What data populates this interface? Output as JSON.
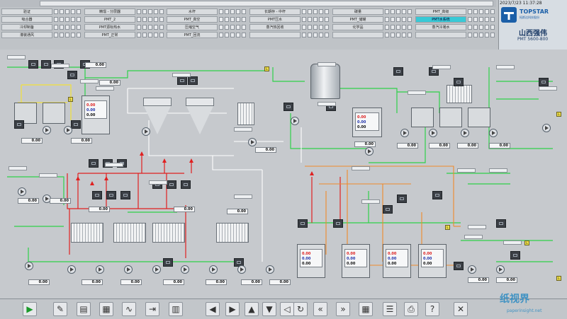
{
  "header": {
    "datetime": "2023/7/23 11:37:28",
    "logo_text": "TOPSTAR",
    "logo_sub": "拓斯达科技股份",
    "site": "山西强伟",
    "model": "PMT 5600-800",
    "alarm_rows": [
      [
        "验证",
        "精馏 - 分层器",
        "水杆",
        "长期存 - 中杆",
        "碳量",
        "PMT_高级"
      ],
      [
        "吸合器",
        "PMT_2",
        "PMT_真空",
        "PMT压水",
        "PMT_储罐",
        "PMT水系统"
      ],
      [
        "冷却制备",
        "PMT源标热水",
        "压缩空气",
        "蒸汽热回收",
        "化学品",
        "蒸汽冷凝水"
      ],
      [
        "灌装通风",
        "PMT_正常",
        "PMT_回流",
        "",
        "",
        ""
      ]
    ],
    "active_alarm": "PMT水系统"
  },
  "process": {
    "values": [
      "0.00",
      "0.00",
      "0.00",
      "0.00",
      "0.00",
      "0.00",
      "0.00",
      "0.00",
      "0.00",
      "0.00",
      "0.00",
      "0.00",
      "0.00",
      "0.00",
      "0.00",
      "0.00",
      "0.00",
      "0.00",
      "0.00",
      "0.00",
      "0.00",
      "0.00",
      "0.00",
      "0.00"
    ],
    "vessel_readings": [
      "0.00",
      "0.00",
      "0.00"
    ],
    "markers": [
      "L",
      "L",
      "L",
      "L",
      "L",
      "L"
    ]
  },
  "toolbar": {
    "icons": [
      "play-icon",
      "tool-icon",
      "folder-icon",
      "panel-icon",
      "trend-icon",
      "export-icon",
      "report-icon",
      "back-icon",
      "forward-icon",
      "up-icon",
      "down-icon",
      "left-icon",
      "refresh-icon",
      "prev-icon",
      "next-icon",
      "grid-icon",
      "list-icon",
      "print-icon",
      "help-icon",
      "exit-icon"
    ]
  },
  "watermark": {
    "main": "纸视界",
    "sub": "paperinsight.net"
  },
  "colors": {
    "pipe_green": "#2fd24a",
    "pipe_red": "#e02020",
    "pipe_orange": "#f08a2a",
    "pipe_white": "#ffffff",
    "pipe_yellow": "#f2e13a",
    "highlight": "#38c9d6"
  }
}
